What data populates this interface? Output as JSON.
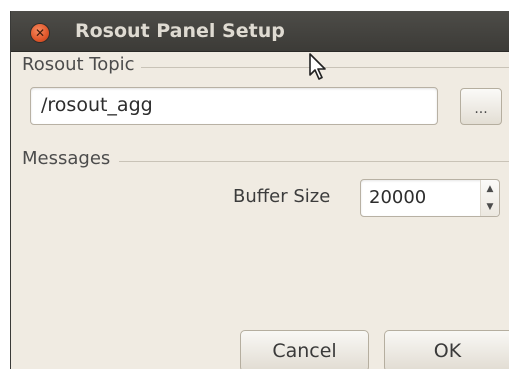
{
  "window": {
    "title": "Rosout Panel Setup",
    "close_glyph": "✕"
  },
  "rosout_topic": {
    "group_label": "Rosout Topic",
    "value": "/rosout_agg",
    "browse_label": "..."
  },
  "messages": {
    "group_label": "Messages",
    "buffer_size_label": "Buffer Size",
    "buffer_size_value": "20000"
  },
  "buttons": {
    "cancel_label": "Cancel",
    "ok_label": "OK"
  },
  "icons": {
    "close": "close-icon",
    "spin_up": "chevron-up-icon",
    "spin_down": "chevron-down-icon",
    "cursor": "mouse-cursor-icon"
  },
  "colors": {
    "titlebar": "#3c3b37",
    "window_bg": "#f0ebe2",
    "close_button": "#e0562a"
  }
}
